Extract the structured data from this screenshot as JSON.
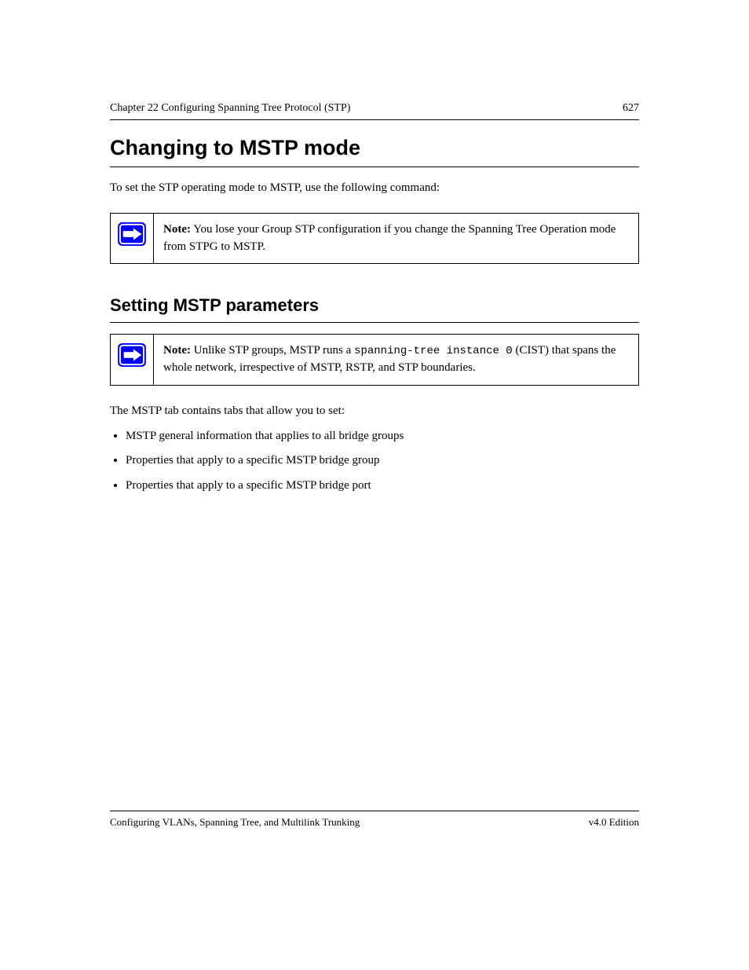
{
  "header": {
    "title": "Chapter 22 Configuring Spanning Tree Protocol (STP)",
    "page": "627"
  },
  "section": {
    "heading": "Changing to MSTP mode",
    "paragraph": "To set the STP operating mode to MSTP, use the following command:",
    "note": {
      "label": "Note:",
      "text": "You lose your Group STP configuration if you change the Spanning Tree Operation mode from STPG to MSTP."
    }
  },
  "subsection": {
    "heading": "Setting MSTP parameters",
    "note": {
      "label": "Note:",
      "text1": "Unlike STP groups, MSTP runs a ",
      "code": "spanning-tree instance 0",
      "text2": " (CIST) that spans the whole network, irrespective of MSTP, RSTP, and STP boundaries."
    },
    "intro": "The MSTP tab contains tabs that allow you to set:",
    "bullets": [
      "MSTP general information that applies to all bridge groups",
      "Properties that apply to a specific MSTP bridge group",
      "Properties that apply to a specific MSTP bridge port"
    ]
  },
  "footer": {
    "left": "Configuring VLANs, Spanning Tree, and Multilink Trunking",
    "right": "v4.0 Edition"
  }
}
